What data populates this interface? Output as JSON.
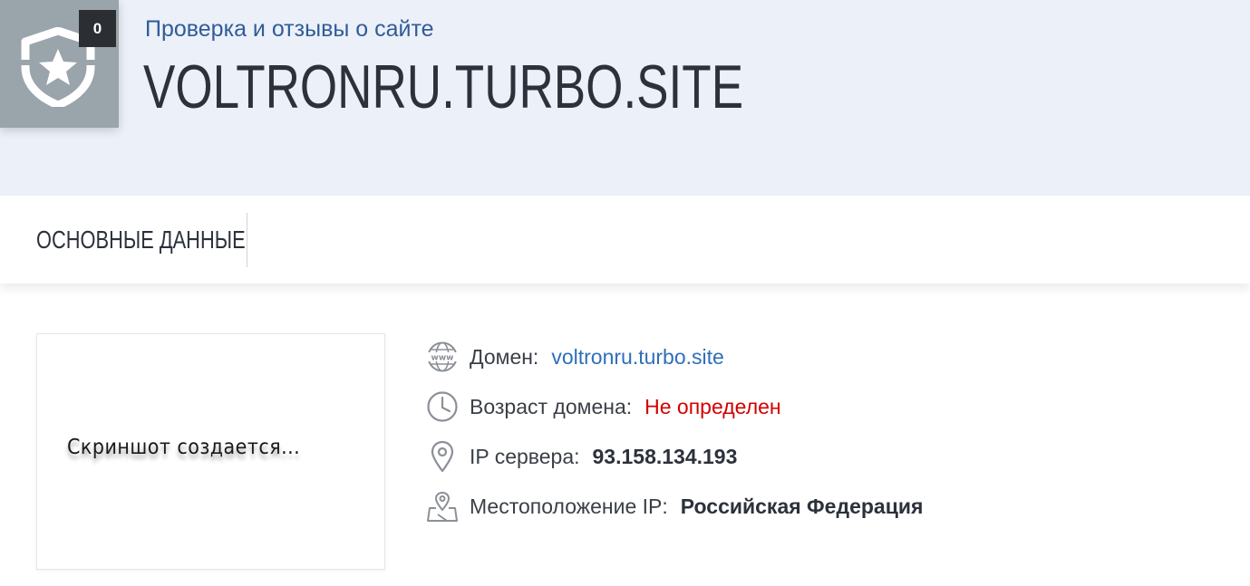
{
  "header": {
    "review_count": "0",
    "subtitle": "Проверка и отзывы о сайте",
    "site_title": "VOLTRONRU.TURBO.SITE",
    "badge_icon": "shield-star-icon"
  },
  "tabs": [
    {
      "label": "ОСНОВНЫЕ ДАННЫЕ"
    }
  ],
  "screenshot": {
    "placeholder_text": "Скриншот создается..."
  },
  "info": {
    "domain": {
      "icon": "www-globe-icon",
      "label": "Домен:",
      "value": "voltronru.turbo.site"
    },
    "age": {
      "icon": "clock-icon",
      "label": "Возраст домена:",
      "value": "Не определен"
    },
    "ip": {
      "icon": "map-pin-icon",
      "label": "IP сервера:",
      "value": "93.158.134.193"
    },
    "location": {
      "icon": "map-location-icon",
      "label": "Местоположение IP:",
      "value": "Российская Федерация"
    }
  },
  "colors": {
    "header_bg": "#ecf0f8",
    "subtitle": "#2f5c98",
    "link": "#2f6fba",
    "warning": "#d40000",
    "badge_bg": "#9aa4ab"
  }
}
